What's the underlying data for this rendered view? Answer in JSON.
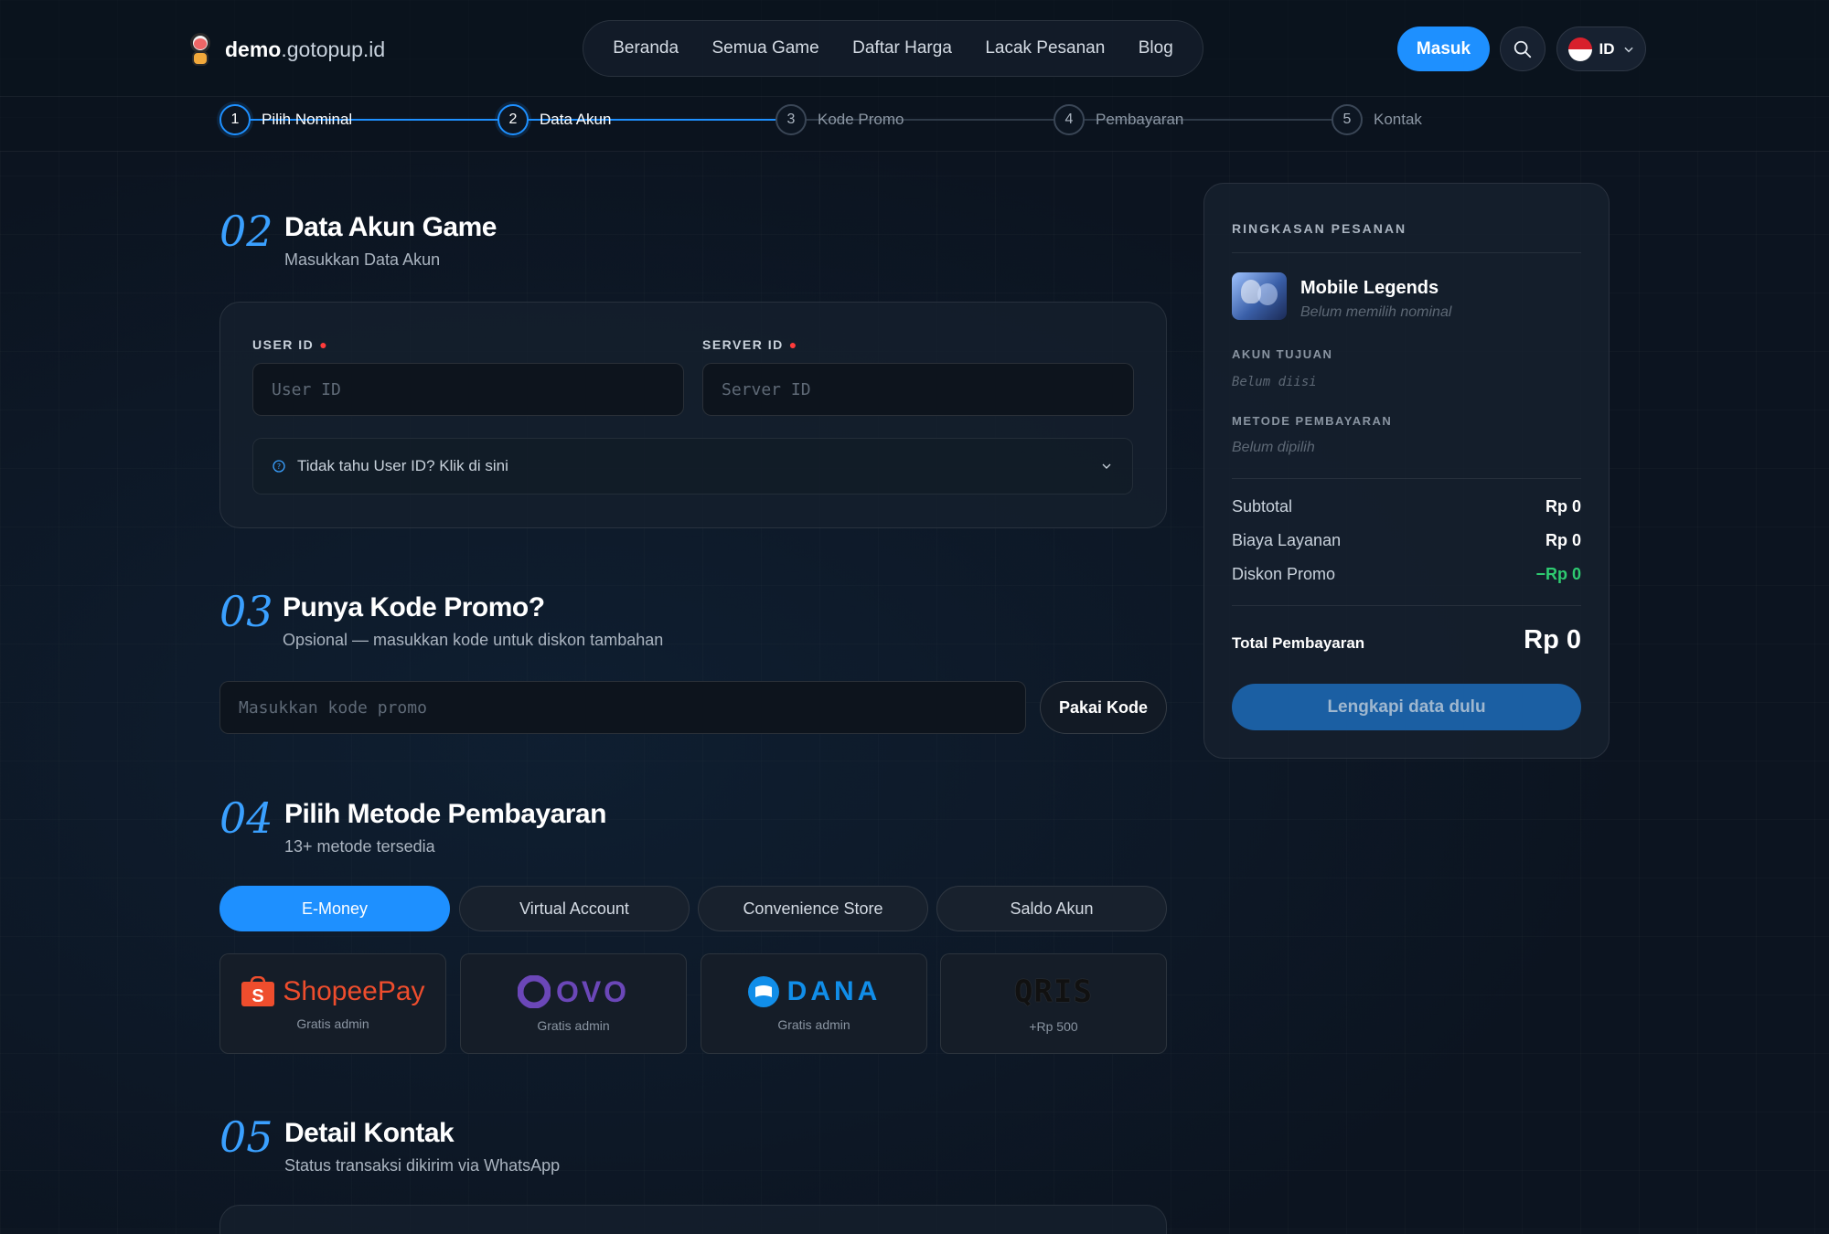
{
  "header": {
    "logo_bold": "demo",
    "logo_rest": ".gotopup.id",
    "nav": [
      "Beranda",
      "Semua Game",
      "Daftar Harga",
      "Lacak Pesanan",
      "Blog"
    ],
    "login_label": "Masuk",
    "lang": "ID"
  },
  "stepper": [
    {
      "num": "1",
      "label": "Pilih Nominal"
    },
    {
      "num": "2",
      "label": "Data Akun"
    },
    {
      "num": "3",
      "label": "Kode Promo"
    },
    {
      "num": "4",
      "label": "Pembayaran"
    },
    {
      "num": "5",
      "label": "Kontak"
    }
  ],
  "account": {
    "num": "02",
    "title": "Data Akun Game",
    "subtitle": "Masukkan Data Akun",
    "user_id_label": "USER ID",
    "user_id_placeholder": "User ID",
    "server_id_label": "SERVER ID",
    "server_id_placeholder": "Server ID",
    "help_text": "Tidak tahu User ID? Klik di sini"
  },
  "promo": {
    "num": "03",
    "title": "Punya Kode Promo?",
    "subtitle": "Opsional — masukkan kode untuk diskon tambahan",
    "placeholder": "Masukkan kode promo",
    "button": "Pakai Kode"
  },
  "payment": {
    "num": "04",
    "title": "Pilih Metode Pembayaran",
    "subtitle": "13+ metode tersedia",
    "tabs": [
      "E-Money",
      "Virtual Account",
      "Convenience Store",
      "Saldo Akun"
    ],
    "methods": [
      {
        "name": "ShopeePay",
        "note": "Gratis admin"
      },
      {
        "name": "OVO",
        "note": "Gratis admin"
      },
      {
        "name": "DANA",
        "note": "Gratis admin"
      },
      {
        "name": "QRIS",
        "note": "+Rp 500"
      }
    ]
  },
  "contact": {
    "num": "05",
    "title": "Detail Kontak",
    "subtitle": "Status transaksi dikirim via WhatsApp"
  },
  "summary": {
    "heading": "RINGKASAN PESANAN",
    "game": "Mobile Legends",
    "game_note": "Belum memilih nominal",
    "account_label": "AKUN TUJUAN",
    "account_value": "Belum diisi",
    "method_label": "METODE PEMBAYARAN",
    "method_value": "Belum dipilih",
    "subtotal_label": "Subtotal",
    "subtotal": "Rp 0",
    "fee_label": "Biaya Layanan",
    "fee": "Rp 0",
    "discount_label": "Diskon Promo",
    "discount": "−Rp 0",
    "total_label": "Total Pembayaran",
    "total": "Rp 0",
    "cta": "Lengkapi data dulu"
  },
  "colors": {
    "accent": "#1e90ff",
    "discount": "#2ecc71",
    "required": "#ff3b3b"
  }
}
